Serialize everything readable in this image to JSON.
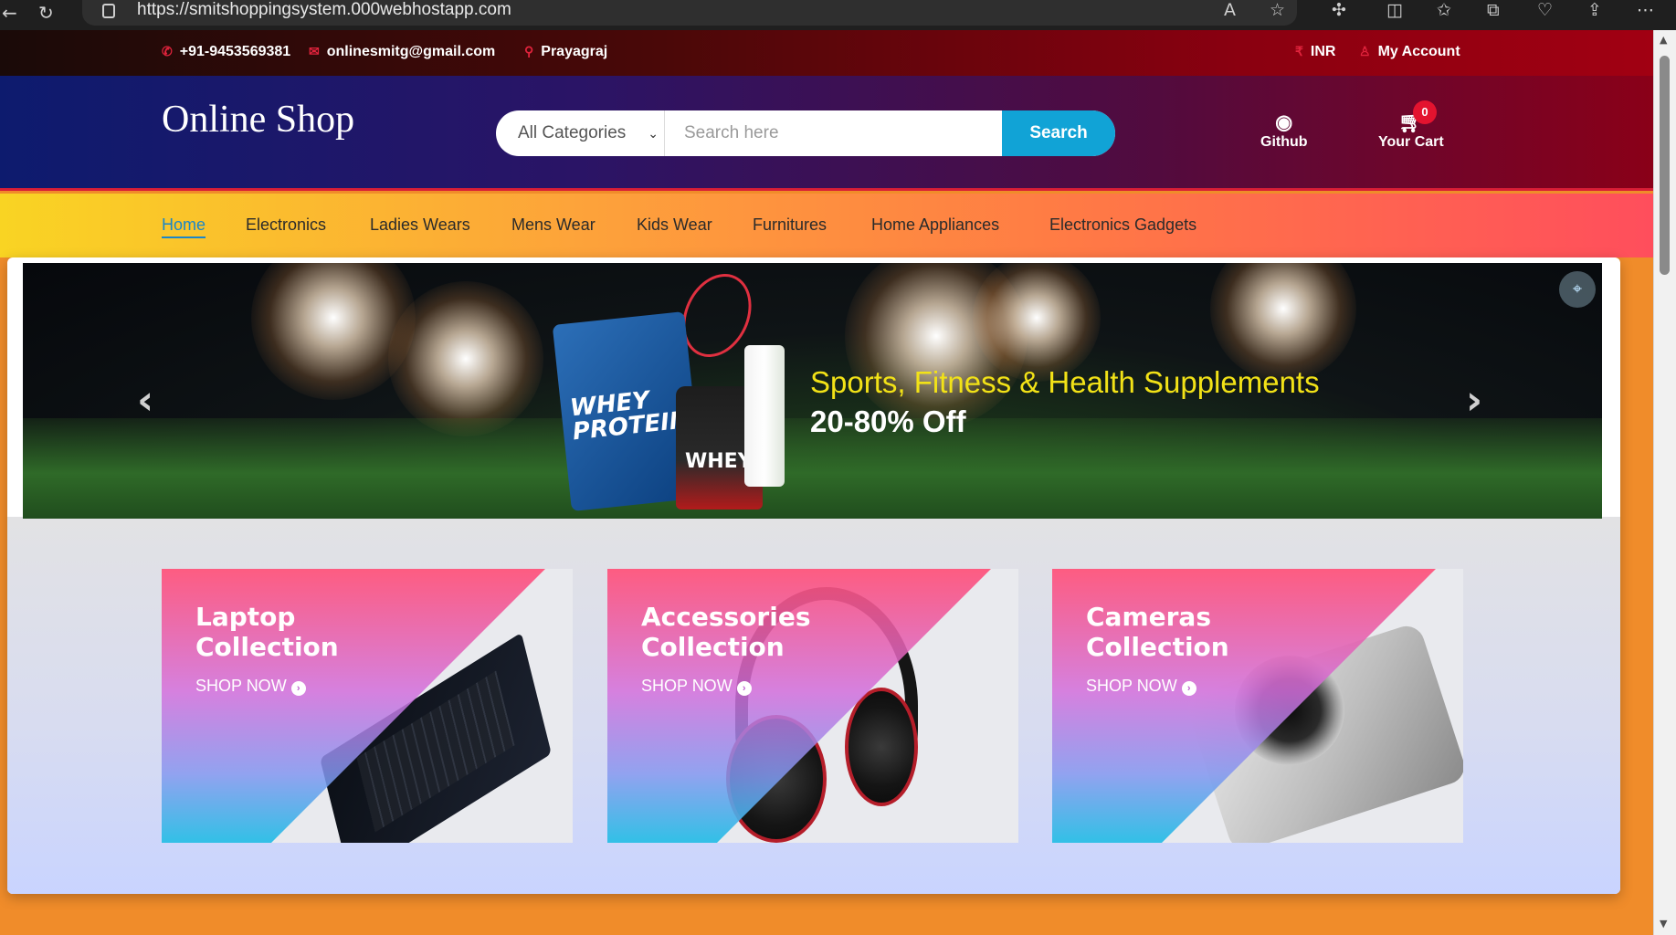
{
  "browser": {
    "url": "https://smitshoppingsystem.000webhostapp.com",
    "back_icon": "back-arrow-icon",
    "reload_icon": "reload-icon",
    "read_aloud_icon": "read-aloud-icon",
    "favorite_icon": "star-icon"
  },
  "topbar": {
    "phone": "+91-9453569381",
    "email": "onlinesmitg@gmail.com",
    "location": "Prayagraj",
    "currency": "INR",
    "account": "My Account",
    "icon_color": "#e0233c"
  },
  "header": {
    "logo": "Online Shop",
    "search": {
      "category": "All Categories",
      "placeholder": "Search here",
      "button": "Search",
      "button_color": "#11a3d6"
    },
    "github_label": "Github",
    "cart_label": "Your Cart",
    "cart_count": "0"
  },
  "nav": {
    "items": [
      {
        "label": "Home",
        "active": true
      },
      {
        "label": "Electronics"
      },
      {
        "label": "Ladies Wears"
      },
      {
        "label": "Mens Wear"
      },
      {
        "label": "Kids Wear"
      },
      {
        "label": "Furnitures"
      },
      {
        "label": "Home Appliances"
      },
      {
        "label": "Electronics Gadgets"
      }
    ],
    "active_color": "#1b86c8"
  },
  "banner": {
    "title": "Sports, Fitness & Health Supplements",
    "subtitle": "20-80% Off",
    "title_color": "#f2e217",
    "product_tub_text": "WHEY PROTEIN",
    "product_jar_text": "WHEY",
    "prev_icon": "chevron-left-icon",
    "next_icon": "chevron-right-icon"
  },
  "collections": [
    {
      "title_line1": "Laptop",
      "title_line2": "Collection",
      "cta": "SHOP NOW"
    },
    {
      "title_line1": "Accessories",
      "title_line2": "Collection",
      "cta": "SHOP NOW"
    },
    {
      "title_line1": "Cameras",
      "title_line2": "Collection",
      "cta": "SHOP NOW"
    }
  ]
}
